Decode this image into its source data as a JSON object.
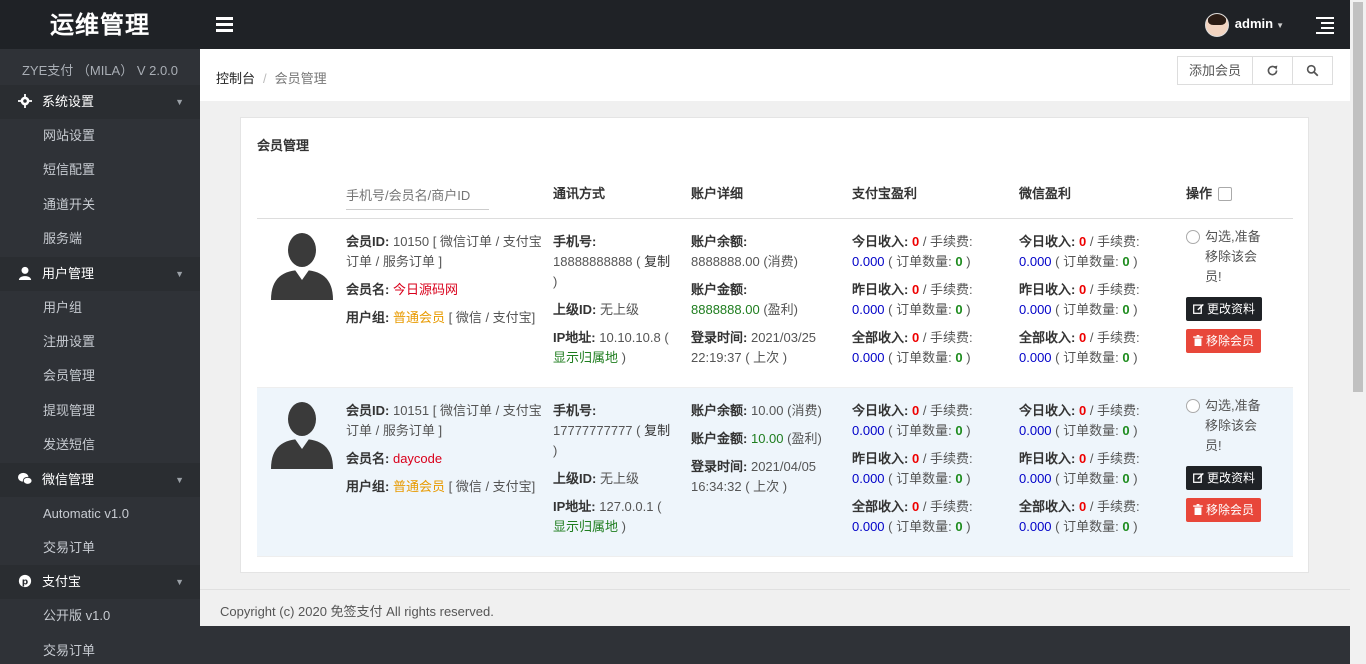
{
  "sidebar": {
    "logo": "运维管理",
    "version": "ZYE支付 （MILA） V 2.0.0",
    "groups": [
      {
        "label": "系统设置",
        "items": [
          "网站设置",
          "短信配置",
          "通道开关",
          "服务端"
        ]
      },
      {
        "label": "用户管理",
        "items": [
          "用户组",
          "注册设置",
          "会员管理",
          "提现管理",
          "发送短信"
        ]
      },
      {
        "label": "微信管理",
        "items": [
          "Automatic v1.0",
          "交易订单"
        ]
      },
      {
        "label": "支付宝",
        "items": [
          "公开版 v1.0",
          "交易订单"
        ]
      }
    ]
  },
  "header": {
    "username": "admin"
  },
  "breadcrumb": {
    "home": "控制台",
    "current": "会员管理",
    "add_button": "添加会员"
  },
  "panel": {
    "title": "会员管理"
  },
  "table": {
    "search_placeholder": "手机号/会员名/商户ID",
    "headers": {
      "contact": "通讯方式",
      "account": "账户详细",
      "alipay": "支付宝盈利",
      "wechat": "微信盈利",
      "ops": "操作"
    },
    "labels": {
      "member_id": "会员ID:",
      "member_name": "会员名:",
      "group": "用户组:",
      "phone": "手机号:",
      "copy": "复制",
      "parent": "上级ID:",
      "ip": "IP地址:",
      "show_location": "显示归属地",
      "balance": "账户余额:",
      "amount": "账户金额:",
      "login_time": "登录时间:",
      "today_income": "今日收入:",
      "yesterday_income": "昨日收入:",
      "all_income": "全部收入:",
      "fee": "手续费:",
      "order_count": "订单数量:",
      "select_hint": "勾选,准备移除该会员!",
      "edit_btn": "更改资料",
      "delete_btn": "移除会员",
      "spent": "(消费)",
      "profit": "(盈利)",
      "last": "( 上次 )"
    },
    "rows": [
      {
        "id": "10150",
        "perms": "[ 微信订单 / 支付宝订单 / 服务订单 ]",
        "name": "今日源码网",
        "group": "普通会员",
        "group_perms": "[ 微信 / 支付宝]",
        "phone": "18888888888",
        "parent": "无上级",
        "ip": "10.10.10.8",
        "balance": "8888888.00",
        "amount": "8888888.00",
        "login_time": "2021/03/25 22:19:37",
        "ali": {
          "today": "0",
          "today_fee": "0.000",
          "today_orders": "0",
          "yest": "0",
          "yest_fee": "0.000",
          "yest_orders": "0",
          "all": "0",
          "all_fee": "0.000",
          "all_orders": "0"
        },
        "wx": {
          "today": "0",
          "today_fee": "0.000",
          "today_orders": "0",
          "yest": "0",
          "yest_fee": "0.000",
          "yest_orders": "0",
          "all": "0",
          "all_fee": "0.000",
          "all_orders": "0"
        }
      },
      {
        "id": "10151",
        "perms": "[ 微信订单 / 支付宝订单 / 服务订单 ]",
        "name": "daycode",
        "group": "普通会员",
        "group_perms": "[ 微信 / 支付宝]",
        "phone": "17777777777",
        "parent": "无上级",
        "ip": "127.0.0.1",
        "balance": "10.00",
        "amount": "10.00",
        "login_time": "2021/04/05 16:34:32",
        "ali": {
          "today": "0",
          "today_fee": "0.000",
          "today_orders": "0",
          "yest": "0",
          "yest_fee": "0.000",
          "yest_orders": "0",
          "all": "0",
          "all_fee": "0.000",
          "all_orders": "0"
        },
        "wx": {
          "today": "0",
          "today_fee": "0.000",
          "today_orders": "0",
          "yest": "0",
          "yest_fee": "0.000",
          "yest_orders": "0",
          "all": "0",
          "all_fee": "0.000",
          "all_orders": "0"
        }
      }
    ]
  },
  "footer": {
    "text": "Copyright (c) 2020 免签支付 All rights reserved."
  }
}
